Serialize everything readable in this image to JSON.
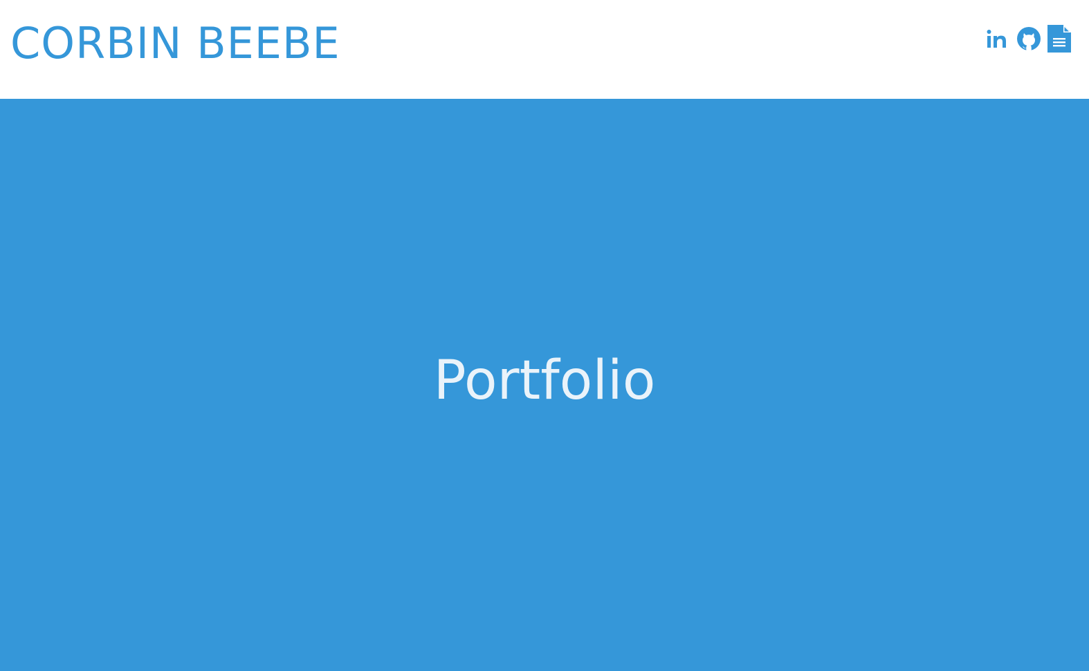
{
  "header": {
    "site_title": "CORBIN BEEBE",
    "social_links": [
      {
        "icon": "linkedin-icon",
        "label": "in"
      },
      {
        "icon": "github-icon"
      },
      {
        "icon": "resume-document-icon"
      }
    ]
  },
  "hero": {
    "title": "Portfolio"
  },
  "colors": {
    "brand_blue": "#3597d9",
    "hero_text": "#eaf3fa",
    "header_background": "#ffffff"
  }
}
